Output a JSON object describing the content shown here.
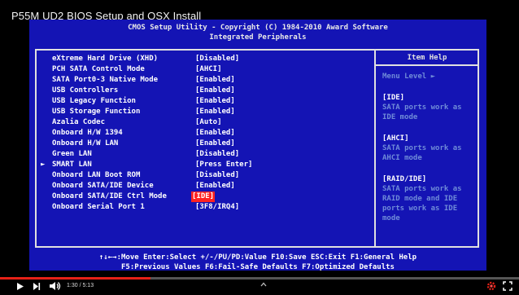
{
  "video": {
    "title": "P55M UD2 BIOS Setup and OSX Install",
    "time": "1:30 / 5:13",
    "progress": 0.29
  },
  "bios": {
    "header_line1": "CMOS Setup Utility - Copyright (C) 1984-2010 Award Software",
    "header_line2": "Integrated Peripherals",
    "items": [
      {
        "label": "eXtreme Hard Drive (XHD)",
        "value": "[Disabled]"
      },
      {
        "label": "PCH SATA Control Mode",
        "value": "[AHCI]"
      },
      {
        "label": "SATA Port0-3 Native Mode",
        "value": "[Enabled]"
      },
      {
        "label": "USB Controllers",
        "value": "[Enabled]"
      },
      {
        "label": "USB Legacy Function",
        "value": "[Enabled]"
      },
      {
        "label": "USB Storage Function",
        "value": "[Enabled]"
      },
      {
        "label": "Azalia Codec",
        "value": "[Auto]"
      },
      {
        "label": "Onboard H/W 1394",
        "value": "[Enabled]"
      },
      {
        "label": "Onboard H/W LAN",
        "value": "[Enabled]"
      },
      {
        "label": "Green LAN",
        "value": "[Disabled]"
      },
      {
        "label": "SMART LAN",
        "value": "[Press Enter]"
      },
      {
        "label": "Onboard LAN Boot ROM",
        "value": "[Disabled]"
      },
      {
        "label": "Onboard SATA/IDE Device",
        "value": "[Enabled]"
      },
      {
        "label": "Onboard SATA/IDE Ctrl Mode",
        "value": "[IDE]"
      },
      {
        "label": "Onboard Serial Port 1",
        "value": "[3F8/IRQ4]"
      }
    ],
    "submenu_marker": "►",
    "help": {
      "title": "Item Help",
      "menu_level": "Menu Level   ►",
      "blocks": [
        {
          "header": "[IDE]",
          "text": "SATA ports work as IDE mode"
        },
        {
          "header": "[AHCI]",
          "text": "SATA ports work as AHCI mode"
        },
        {
          "header": "[RAID/IDE]",
          "text": "SATA ports work as RAID mode and IDE ports work as IDE mode"
        }
      ]
    },
    "keys_line1": "↑↓←→:Move   Enter:Select   +/-/PU/PD:Value   F10:Save   ESC:Exit   F1:General Help",
    "keys_line2": "F5:Previous Values   F6:Fail-Safe Defaults   F7:Optimized Defaults"
  },
  "colors": {
    "bios_bg": "#1414b4",
    "help_text": "#6f8bd8",
    "highlight": "#ff2222",
    "progress": "#e62117"
  },
  "icons": [
    "play-icon",
    "next-icon",
    "volume-icon",
    "settings-icon",
    "fullscreen-icon",
    "chevron-up-icon"
  ]
}
